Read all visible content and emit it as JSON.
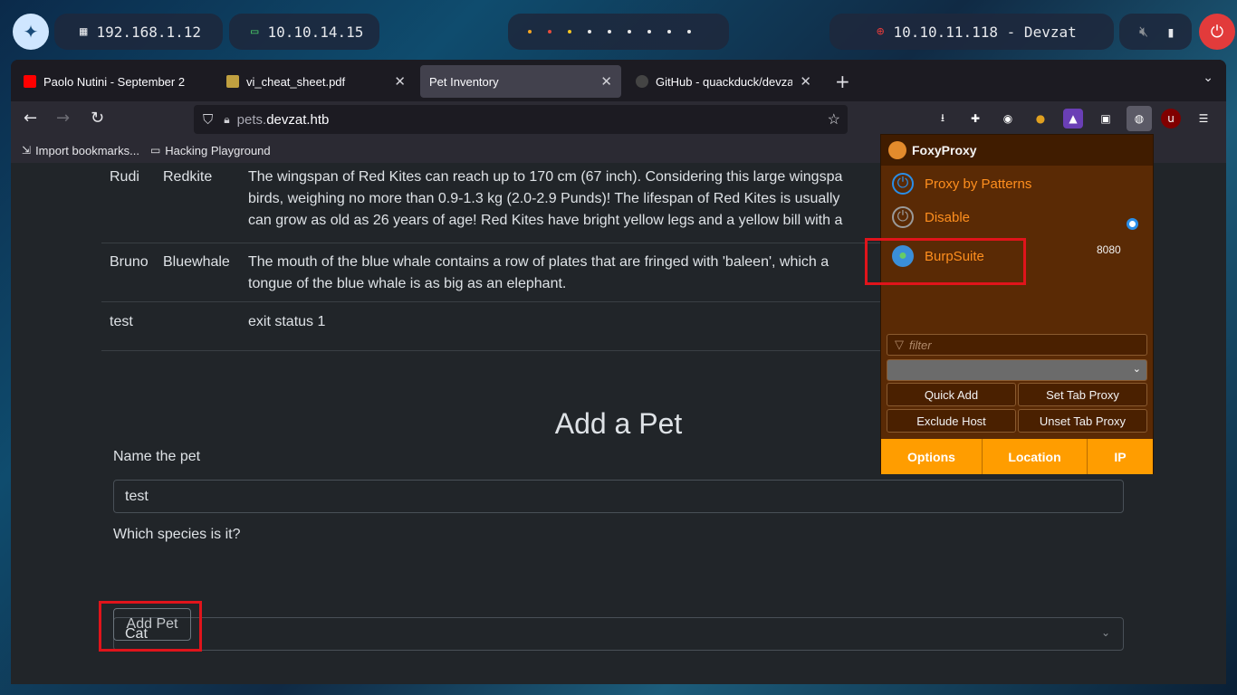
{
  "desktop": {
    "ip_local": "192.168.1.12",
    "ip_vpn": "10.10.14.15",
    "target": "10.10.11.118 - Devzat"
  },
  "tabs": [
    {
      "title": "Paolo Nutini - September 2"
    },
    {
      "title": "vi_cheat_sheet.pdf"
    },
    {
      "title": "Pet Inventory"
    },
    {
      "title": "GitHub - quackduck/devzat"
    }
  ],
  "url": {
    "prefix": "pets.",
    "domain": "devzat.htb"
  },
  "bookmarks": [
    {
      "label": "Import bookmarks..."
    },
    {
      "label": "Hacking Playground"
    }
  ],
  "pets": [
    {
      "name": "Rudi",
      "species": "Redkite",
      "lines": [
        "The wingspan of Red Kites can reach up to 170 cm (67 inch). Considering this large wingspa",
        "birds, weighing no more than 0.9-1.3 kg (2.0-2.9 Punds)! The lifespan of Red Kites is usually",
        "can grow as old as 26 years of age! Red Kites have bright yellow legs and a yellow bill with a"
      ]
    },
    {
      "name": "Bruno",
      "species": "Bluewhale",
      "lines": [
        "The mouth of the blue whale contains a row of plates that are fringed with 'baleen', which a",
        "tongue of the blue whale is as big as an elephant."
      ]
    },
    {
      "name": "test",
      "species": "",
      "lines": [
        "exit status 1"
      ]
    }
  ],
  "form": {
    "title": "Add a Pet",
    "name_label": "Name the pet",
    "name_value": "test",
    "species_label": "Which species is it?",
    "species_value": "Cat",
    "submit_label": "Add Pet"
  },
  "foxyproxy": {
    "title": "FoxyProxy",
    "modes": [
      {
        "label": "Proxy by Patterns"
      },
      {
        "label": "Disable"
      },
      {
        "label": "BurpSuite",
        "port": "8080"
      }
    ],
    "filter_placeholder": "filter",
    "buttons": [
      "Quick Add",
      "Set Tab Proxy",
      "Exclude Host",
      "Unset Tab Proxy"
    ],
    "footer": [
      "Options",
      "Location",
      "IP"
    ]
  }
}
